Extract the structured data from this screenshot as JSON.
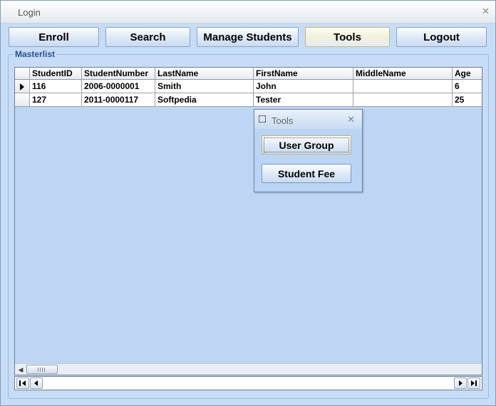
{
  "window": {
    "title": "Login"
  },
  "toolbar": {
    "enroll": "Enroll",
    "search": "Search",
    "manage_students": "Manage Students",
    "tools": "Tools",
    "logout": "Logout"
  },
  "masterlist": {
    "label": "Masterlist",
    "columns": [
      "StudentID",
      "StudentNumber",
      "LastName",
      "FirstName",
      "MiddleName",
      "Age"
    ],
    "rows": [
      [
        "116",
        "2006-0000001",
        "Smith",
        "John",
        "",
        "6"
      ],
      [
        "127",
        "2011-0000117",
        "Softpedia",
        "Tester",
        "",
        "25"
      ]
    ],
    "selected_row": 0
  },
  "tools_window": {
    "title": "Tools",
    "user_group": "User Group",
    "student_fee": "Student Fee"
  },
  "colors": {
    "window_bg": "#c7dcf7",
    "grid_bg": "#bed5f4",
    "accent": "#2a4f8f"
  }
}
